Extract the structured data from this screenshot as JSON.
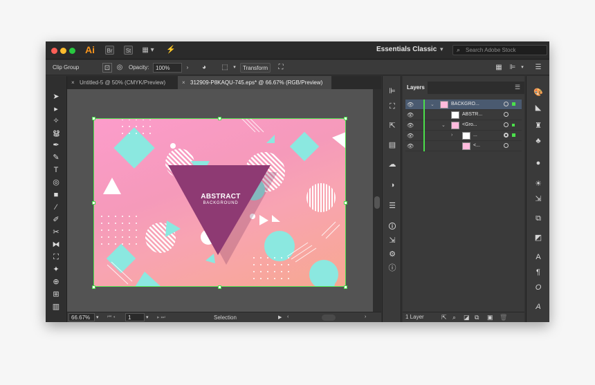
{
  "titlebar": {
    "app_logo": "Ai",
    "bridge_icon": "Br",
    "stock_icon": "St",
    "workspace": "Essentials Classic",
    "search_placeholder": "Search Adobe Stock"
  },
  "controlbar": {
    "selection_type": "Clip Group",
    "opacity_label": "Opacity:",
    "opacity_value": "100%",
    "transform_label": "Transform"
  },
  "tabs": [
    {
      "label": "Untitled-5 @ 50% (CMYK/Preview)",
      "active": false
    },
    {
      "label": "312909-P8KAQU-745.eps* @ 66.67% (RGB/Preview)",
      "active": true
    }
  ],
  "artwork": {
    "title": "ABSTRACT",
    "subtitle": "BACKGROUND",
    "colors": {
      "mint": "#8be8e0",
      "plum": "#8e3a73",
      "white": "#ffffff"
    }
  },
  "statusbar": {
    "zoom": "66.67%",
    "artboard": "1",
    "tool": "Selection"
  },
  "layers": {
    "tab": "Layers",
    "rows": [
      {
        "name": "BACKGRO...",
        "selected": true
      },
      {
        "name": "ABSTR..."
      },
      {
        "name": "<Gro..."
      },
      {
        "name": "..."
      },
      {
        "name": "<..."
      }
    ],
    "count": "1 Layer"
  },
  "icons": {
    "accent": "#4be04b"
  }
}
